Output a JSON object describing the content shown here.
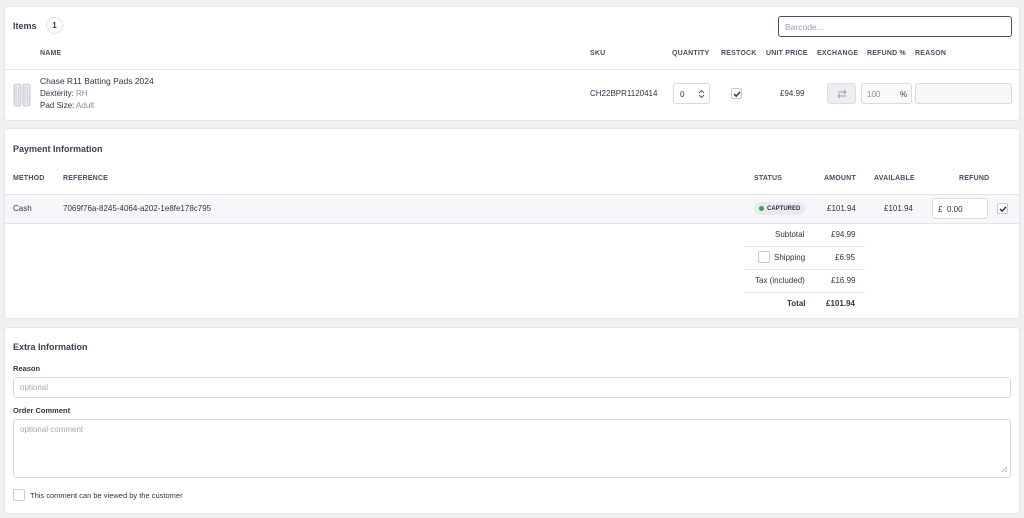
{
  "items": {
    "title": "Items",
    "count": "1",
    "barcode_placeholder": "Barcode...",
    "columns": [
      "NAME",
      "SKU",
      "QUANTITY",
      "RESTOCK",
      "UNIT PRICE",
      "EXCHANGE",
      "REFUND %",
      "REASON"
    ],
    "row": {
      "name": "Chase R11 Batting Pads 2024",
      "dexterity_label": "Dexterity:",
      "dexterity_value": "RH",
      "pad_size_label": "Pad Size:",
      "pad_size_value": "Adult",
      "sku": "CH22BPR1120414",
      "quantity": "0",
      "restock_checked": true,
      "unit_price": "£94.99",
      "refund_percent": "100",
      "percent_sign": "%",
      "reason": ""
    }
  },
  "payment": {
    "title": "Payment Information",
    "columns": [
      "METHOD",
      "REFERENCE",
      "STATUS",
      "AMOUNT",
      "AVAILABLE",
      "REFUND"
    ],
    "row": {
      "method": "Cash",
      "reference": "7069f76a-8245-4064-a202-1e8fe178c795",
      "status": "CAPTURED",
      "amount": "£101.94",
      "available": "£101.94",
      "currency": "£",
      "refund": "0.00",
      "refund_checked": true
    },
    "summary": {
      "subtotal_label": "Subtotal",
      "subtotal": "£94.99",
      "shipping_label": "Shipping",
      "shipping": "£6.95",
      "shipping_checked": false,
      "tax_label": "Tax (included)",
      "tax": "£16.99",
      "total_label": "Total",
      "total": "£101.94"
    }
  },
  "extra": {
    "title": "Extra Information",
    "reason_label": "Reason",
    "reason_placeholder": "optional",
    "comment_label": "Order Comment",
    "comment_placeholder": "optional comment",
    "customer_visible_label": "This comment can be viewed by the customer",
    "customer_visible_checked": false
  },
  "colors": {
    "status_green": "#2fa84f",
    "badge_bg": "#eceef2",
    "text": "#303548"
  }
}
